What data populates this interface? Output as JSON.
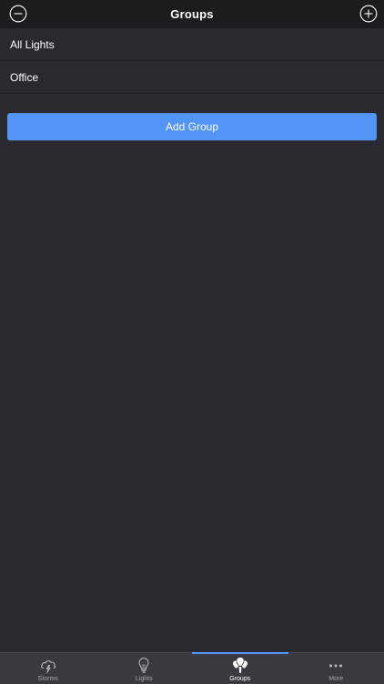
{
  "navbar": {
    "title": "Groups",
    "left_icon": "minus-circle-icon",
    "right_icon": "plus-circle-icon"
  },
  "groups": [
    {
      "label": "All Lights"
    },
    {
      "label": "Office"
    }
  ],
  "add_group_label": "Add Group",
  "tabbar": {
    "active": "groups",
    "tabs": [
      {
        "label": "Storms",
        "icon": "storm-cloud-icon"
      },
      {
        "label": "Lights",
        "icon": "lightbulb-icon"
      },
      {
        "label": "Groups",
        "icon": "group-bulbs-icon"
      },
      {
        "label": "More",
        "icon": "more-dots-icon"
      }
    ]
  },
  "colors": {
    "background": "#2a292f",
    "navbar": "#1c1b20",
    "accent": "#5295f7",
    "tabbar": "#3a3940"
  }
}
